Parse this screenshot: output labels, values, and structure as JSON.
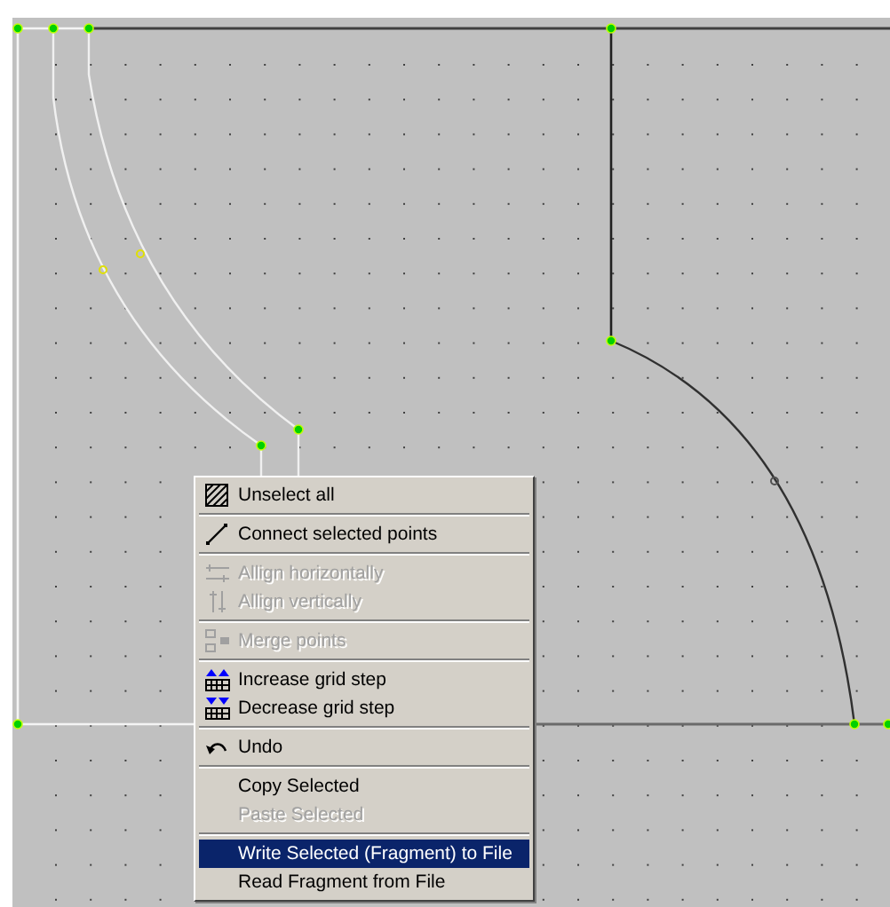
{
  "context_menu": {
    "items": [
      {
        "kind": "item",
        "label": "Unselect all",
        "disabled": false,
        "selected": false
      },
      {
        "kind": "separator"
      },
      {
        "kind": "item",
        "label": "Connect selected points",
        "disabled": false,
        "selected": false
      },
      {
        "kind": "separator"
      },
      {
        "kind": "item",
        "label": "Allign horizontally",
        "disabled": true,
        "selected": false
      },
      {
        "kind": "item",
        "label": "Allign vertically",
        "disabled": true,
        "selected": false
      },
      {
        "kind": "separator"
      },
      {
        "kind": "item",
        "label": "Merge points",
        "disabled": true,
        "selected": false
      },
      {
        "kind": "separator"
      },
      {
        "kind": "item",
        "label": "Increase grid step",
        "disabled": false,
        "selected": false
      },
      {
        "kind": "item",
        "label": "Decrease grid step",
        "disabled": false,
        "selected": false
      },
      {
        "kind": "separator"
      },
      {
        "kind": "item",
        "label": "Undo",
        "disabled": false,
        "selected": false
      },
      {
        "kind": "separator"
      },
      {
        "kind": "item",
        "label": "Copy Selected",
        "disabled": false,
        "selected": false
      },
      {
        "kind": "item",
        "label": "Paste Selected",
        "disabled": true,
        "selected": false
      },
      {
        "kind": "separator"
      },
      {
        "kind": "item",
        "label": "Write Selected (Fragment) to File",
        "disabled": false,
        "selected": true
      },
      {
        "kind": "item",
        "label": "Read Fragment from File",
        "disabled": false,
        "selected": false
      }
    ]
  }
}
